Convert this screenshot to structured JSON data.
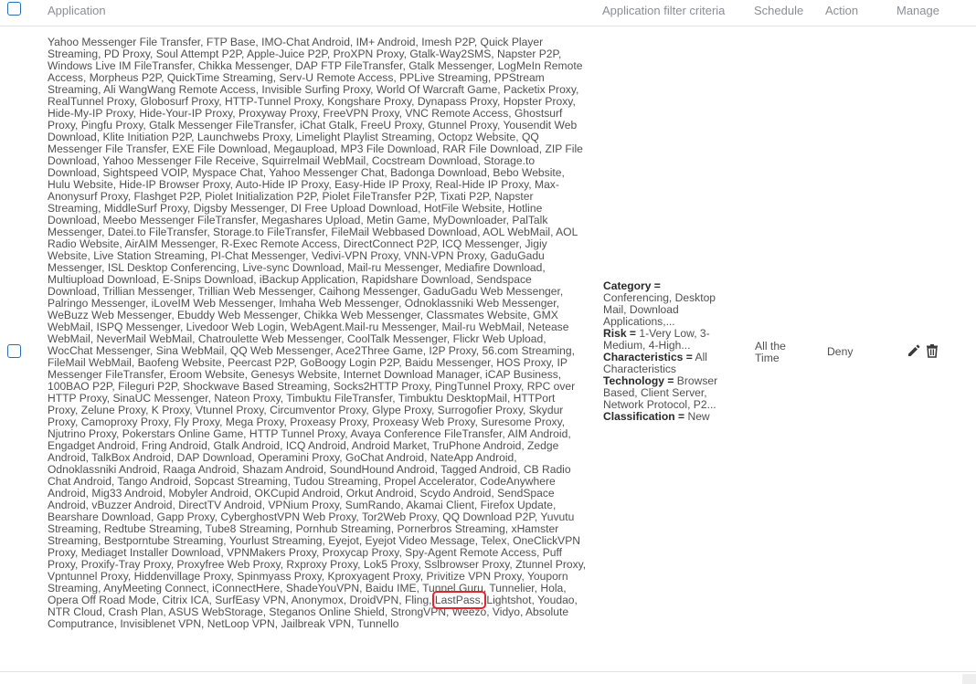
{
  "table": {
    "columns": {
      "application": "Application",
      "criteria": "Application filter criteria",
      "schedule": "Schedule",
      "action": "Action",
      "manage": "Manage"
    },
    "rows": [
      {
        "applications_before": "Yahoo Messenger File Transfer, FTP Base, IMO-Chat Android, IM+ Android, Imesh P2P, Quick Player Streaming, PD Proxy, Soul Attempt P2P, Apple-Juice P2P, ProXPN Proxy, Gtalk-Way2SMS, Napster P2P, Windows Live IM FileTransfer, Chikka Messenger, DAP FTP FileTransfer, Gtalk Messenger, LogMeIn Remote Access, Morpheus P2P, QuickTime Streaming, Serv-U Remote Access, PPLive Streaming, PPStream Streaming, Ali WangWang Remote Access, Invisible Surfing Proxy, World Of Warcraft Game, Packetix Proxy, RealTunnel Proxy, Globosurf Proxy, HTTP-Tunnel Proxy, Kongshare Proxy, Dynapass Proxy, Hopster Proxy, Hide-My-IP Proxy, Hide-Your-IP Proxy, Proxyway Proxy, FreeVPN Proxy, VNC Remote Access, Ghostsurf Proxy, Pingfu Proxy, Gtalk Messenger FileTransfer, iChat Gtalk, FreeU Proxy, Gtunnel Proxy, Yousendit Web Download, Klite Initiation P2P, Launchwebs Proxy, Limelight Playlist Streaming, Octopz Website, QQ Messenger File Transfer, EXE File Download, Megaupload, MP3 File Download, RAR File Download, ZIP File Download, Yahoo Messenger File Receive, Squirrelmail WebMail, Cocstream Download, Storage.to Download, Sightspeed VOIP, Myspace Chat, Yahoo Messenger Chat, Badonga Download, Bebo Website, Hulu Website, Hide-IP Browser Proxy, Auto-Hide IP Proxy, Easy-Hide IP Proxy, Real-Hide IP Proxy, Max-Anonysurf Proxy, Flashget P2P, Piolet Initialization P2P, Piolet FileTransfer P2P, Tixati P2P, Napster Streaming, MiddleSurf Proxy, Digsby Messenger, DI Free Upload Download, HotFile Website, Hotline Download, Meebo Messenger FileTransfer, Megashares Upload, Metin Game, MyDownloader, PalTalk Messenger, Datei.to FileTransfer, Storage.to FileTransfer, FileMail Webbased Download, AOL WebMail, AOL Radio Website, AirAIM Messenger, R-Exec Remote Access, DirectConnect P2P, ICQ Messenger, Jigiy Website, Live Station Streaming, PI-Chat Messenger, Vedivi-VPN Proxy, VNN-VPN Proxy, GaduGadu Messenger, ISL Desktop Conferencing, Live-sync Download, Mail-ru Messenger, Mediafire Download, Multiupload Download, E-Snips Download, iBackup Application, Rapidshare Download, Sendspace Download, Trillian Messenger, Trillian Web Messenger, Caihong Messenger, GaduGadu Web Messenger, Palringo Messenger, iLoveIM Web Messenger, Imhaha Web Messenger, Odnoklassniki Web Messenger, WeBuzz Web Messenger, Ebuddy Web Messenger, Chikka Web Messenger, Classmates Website, GMX WebMail, ISPQ Messenger, Livedoor Web Login, WebAgent.Mail-ru Messenger, Mail-ru WebMail, Netease WebMail, NeverMail WebMail, Chatroulette Web Messenger, CoolTalk Messenger, Flickr Web Upload, WocChat Messenger, Sina WebMail, QQ Web Messenger, Ace2Three Game, I2P Proxy, 56.com Streaming, FileMail WebMail, Baofeng Website, Peercast P2P, GoBoogy Login P2P, Baidu Messenger, HOS Proxy, IP Messenger FileTransfer, Eroom Website, Genesys Website, Internet Download Manager, iCAP Business, 100BAO P2P, Fileguri P2P, Shockwave Based Streaming, Socks2HTTP Proxy, PingTunnel Proxy, RPC over HTTP Proxy, SinaUC Messenger, Nateon Proxy, Timbuktu FileTransfer, Timbuktu DesktopMail, HTTPort Proxy, Zelune Proxy, K Proxy, Vtunnel Proxy, Circumventor Proxy, Glype Proxy, Surrogofier Proxy, Skydur Proxy, Camoproxy Proxy, Fly Proxy, Mega Proxy, Proxeasy Proxy, Proxeasy Web Proxy, Suresome Proxy, Njutrino Proxy, Pokerstars Online Game, HTTP Tunnel Proxy, Avaya Conference FileTransfer, AIM Android, Engadget Android, Fring Android, Gtalk Android, ICQ Android, Android Market, TruPhone Android, Zedge Android, TalkBox Android, DAP Download, Operamini Proxy, GoChat Android, NateApp Android, Odnoklassniki Android, Raaga Android, Shazam Android, SoundHound Android, Tagged Android, CB Radio Chat Android, Tango Android, Sopcast Streaming, Tudou Streaming, Propel Accelerator, CodeAnywhere Android, Mig33 Android, Mobyler Android, OKCupid Android, Orkut Android, Scydo Android, SendSpace Android, vBuzzer Android, DirectTV Android, VPNium Proxy, SumRando, Akamai Client, Firefox Update, Bearshare Download, Gapp Proxy, CyberghostVPN Web Proxy, Tor2Web Proxy, QQ Download P2P, Yuvutu Streaming, Redtube Streaming, Tube8 Streaming, Pornhub Streaming, Pornerbros Streaming, xHamster Streaming, Bestporntube Streaming, Yourlust Streaming, Eyejot, Eyejot Video Message, Telex, OneClickVPN Proxy, Mediaget Installer Download, VPNMakers Proxy, Proxycap Proxy, Spy-Agent Remote Access, Puff Proxy, Proxify-Tray Proxy, Proxyfree Web Proxy, Rxproxy Proxy, Lok5 Proxy, Sslbrowser Proxy, Ztunnel Proxy, Vpntunnel Proxy, Hiddenvillage Proxy, Spinmyass Proxy, Kproxyagent Proxy, Privitize VPN Proxy, Youporn Streaming, AnyMeeting Connect, iConnectHere, ShadeYouVPN, Baidu IME, Tunnel Guru, Tunnelier, Hola, Opera Off Road Mode, Citrix ICA, SurfEasy VPN, Anonymox, DroidVPN, Fling, ",
        "applications_highlighted": "LastPass,",
        "applications_after": " Lightshot, Youdao, NTR Cloud, Crash Plan, ASUS WebStorage, Steganos Online Shield, StrongVPN, Weezo, Vidyo, Absolute Computrance, Invisiblenet VPN, NetLoop VPN, Jailbreak VPN, Tunnello",
        "criteria": {
          "category_label": "Category",
          "category_value": "Conferencing, Desktop Mail, Download Applications,...",
          "risk_label": "Risk",
          "risk_value": "1-Very Low, 3-Medium, 4-High...",
          "characteristics_label": "Characteristics",
          "characteristics_value": "All Characteristics",
          "technology_label": "Technology",
          "technology_value": "Browser Based, Client Server, Network Protocol, P2...",
          "classification_label": "Classification",
          "classification_value": "New",
          "equals": "="
        },
        "schedule": "All the Time",
        "action": "Deny"
      }
    ]
  },
  "icons": {
    "edit": "pencil-icon",
    "delete": "trash-icon"
  },
  "colors": {
    "accent": "#2b6cb0",
    "highlight": "#e0262b",
    "header_text": "#8a8f96",
    "body_text": "#505050",
    "icon": "#3a3a3a"
  }
}
